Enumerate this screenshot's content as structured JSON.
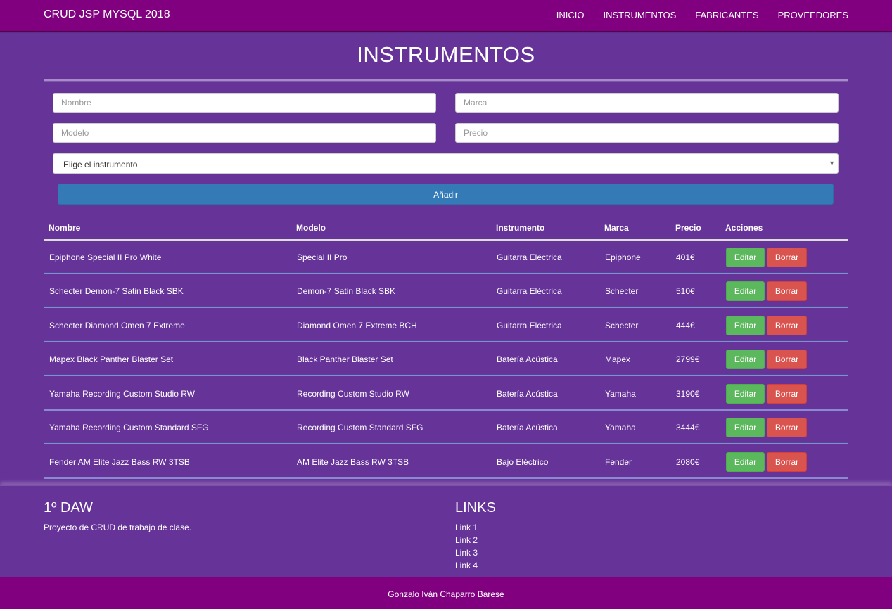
{
  "navbar": {
    "brand": "CRUD JSP MYSQL 2018",
    "links": [
      "INICIO",
      "INSTRUMENTOS",
      "FABRICANTES",
      "PROVEEDORES"
    ]
  },
  "page": {
    "title": "INSTRUMENTOS"
  },
  "form": {
    "nombre_placeholder": "Nombre",
    "marca_placeholder": "Marca",
    "modelo_placeholder": "Modelo",
    "precio_placeholder": "Precio",
    "select_value": "Elige el instrumento",
    "submit_label": "Añadir"
  },
  "table": {
    "headers": [
      "Nombre",
      "Modelo",
      "Instrumento",
      "Marca",
      "Precio",
      "Acciones"
    ],
    "edit_label": "Editar",
    "delete_label": "Borrar",
    "rows": [
      [
        "Epiphone Special II Pro White",
        "Special II Pro",
        "Guitarra Eléctrica",
        "Epiphone",
        "401€"
      ],
      [
        "Schecter Demon-7 Satin Black SBK",
        "Demon-7 Satin Black SBK",
        "Guitarra Eléctrica",
        "Schecter",
        "510€"
      ],
      [
        "Schecter Diamond Omen 7 Extreme",
        "Diamond Omen 7 Extreme BCH",
        "Guitarra Eléctrica",
        "Schecter",
        "444€"
      ],
      [
        "Mapex Black Panther Blaster Set",
        "Black Panther Blaster Set",
        "Batería Acústica",
        "Mapex",
        "2799€"
      ],
      [
        "Yamaha Recording Custom Studio RW",
        "Recording Custom Studio RW",
        "Batería Acústica",
        "Yamaha",
        "3190€"
      ],
      [
        "Yamaha Recording Custom Standard SFG",
        "Recording Custom Standard SFG",
        "Batería Acústica",
        "Yamaha",
        "3444€"
      ],
      [
        "Fender AM Elite Jazz Bass RW 3TSB",
        "AM Elite Jazz Bass RW 3TSB",
        "Bajo Eléctrico",
        "Fender",
        "2080€"
      ]
    ]
  },
  "footer": {
    "left_title": "1º DAW",
    "left_text": "Proyecto de CRUD de trabajo de clase.",
    "links_title": "LINKS",
    "links": [
      "Link 1",
      "Link 2",
      "Link 3",
      "Link 4"
    ]
  },
  "bottom": {
    "author": "Gonzalo Iván Chaparro Barese"
  },
  "colors": {
    "navbar": "#800080",
    "background": "#663399",
    "primary": "#337ab7",
    "success": "#5cb85c",
    "danger": "#d9534f"
  }
}
